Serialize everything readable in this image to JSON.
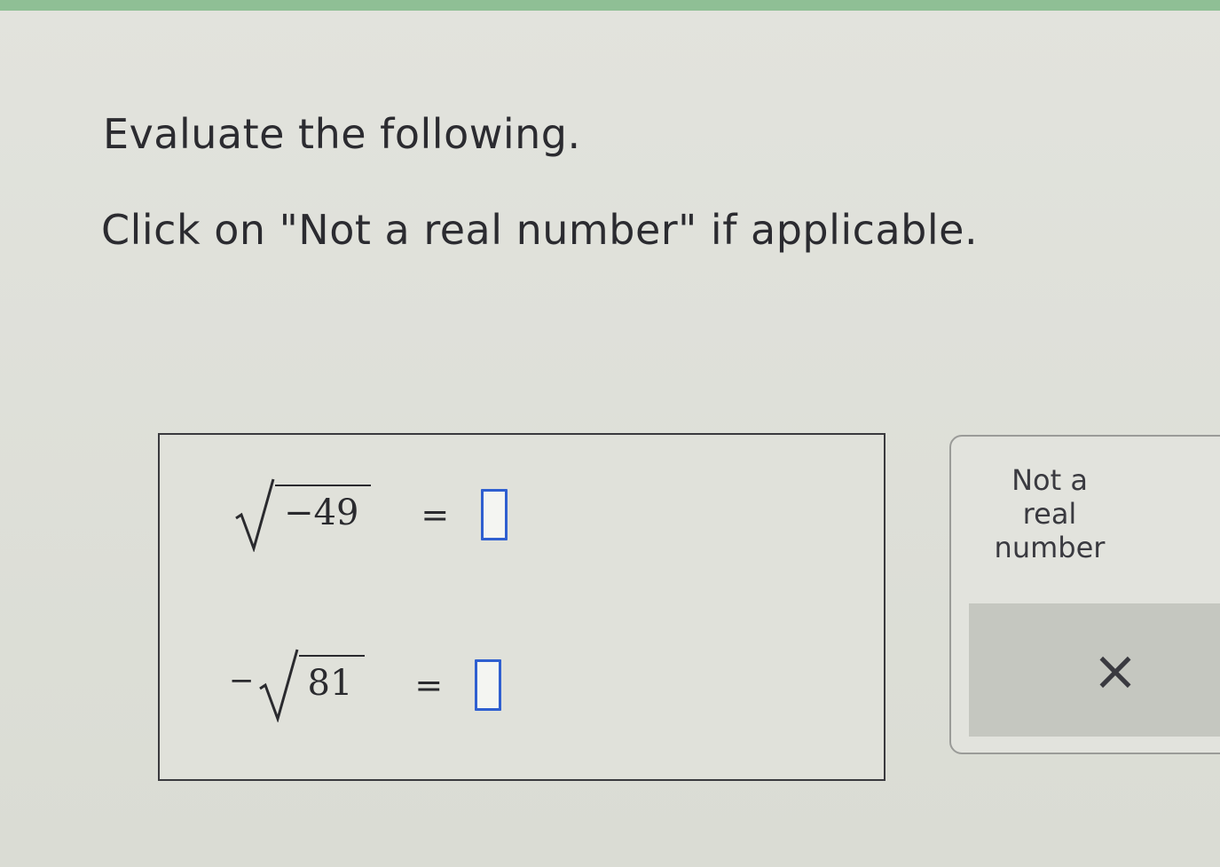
{
  "instructions": {
    "line1": "Evaluate the following.",
    "line2": "Click on \"Not a real number\" if applicable."
  },
  "problems": [
    {
      "prefix": "",
      "radicand": "−49",
      "equals": "=",
      "answer_value": ""
    },
    {
      "prefix": "−",
      "radicand": "81",
      "equals": "=",
      "answer_value": ""
    }
  ],
  "side_panel": {
    "not_real_line1": "Not a",
    "not_real_line2": "real",
    "not_real_line3": "number",
    "clear_icon": "×"
  },
  "colors": {
    "input_border": "#2f5fd0",
    "top_strip": "#8fbf95"
  }
}
